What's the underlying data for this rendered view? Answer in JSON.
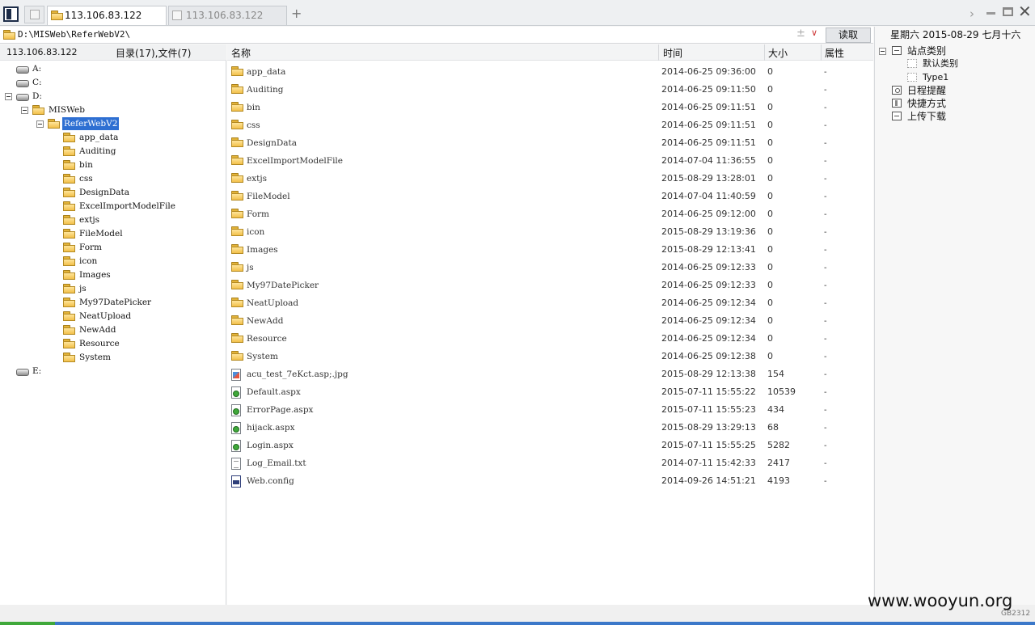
{
  "tabs": [
    {
      "label": "113.106.83.122",
      "active": true
    },
    {
      "label": "113.106.83.122",
      "active": false
    }
  ],
  "new_tab_label": "+",
  "address": {
    "path": "D:\\MISWeb\\ReferWebV2\\",
    "read_button": "读取"
  },
  "left": {
    "host": "113.106.83.122",
    "counts": "目录(17),文件(7)",
    "tree": [
      {
        "label": "A:",
        "type": "drive",
        "depth": 0
      },
      {
        "label": "C:",
        "type": "drive",
        "depth": 0
      },
      {
        "label": "D:",
        "type": "drive",
        "depth": 0,
        "expanded": true
      },
      {
        "label": "MISWeb",
        "type": "folder",
        "depth": 1,
        "expanded": true
      },
      {
        "label": "ReferWebV2",
        "type": "folder",
        "depth": 2,
        "expanded": true,
        "selected": true
      },
      {
        "label": "app_data",
        "type": "folder",
        "depth": 3
      },
      {
        "label": "Auditing",
        "type": "folder",
        "depth": 3
      },
      {
        "label": "bin",
        "type": "folder",
        "depth": 3
      },
      {
        "label": "css",
        "type": "folder",
        "depth": 3
      },
      {
        "label": "DesignData",
        "type": "folder",
        "depth": 3
      },
      {
        "label": "ExcelImportModelFile",
        "type": "folder",
        "depth": 3
      },
      {
        "label": "extjs",
        "type": "folder",
        "depth": 3
      },
      {
        "label": "FileModel",
        "type": "folder",
        "depth": 3
      },
      {
        "label": "Form",
        "type": "folder",
        "depth": 3
      },
      {
        "label": "icon",
        "type": "folder",
        "depth": 3
      },
      {
        "label": "Images",
        "type": "folder",
        "depth": 3
      },
      {
        "label": "js",
        "type": "folder",
        "depth": 3
      },
      {
        "label": "My97DatePicker",
        "type": "folder",
        "depth": 3
      },
      {
        "label": "NeatUpload",
        "type": "folder",
        "depth": 3
      },
      {
        "label": "NewAdd",
        "type": "folder",
        "depth": 3
      },
      {
        "label": "Resource",
        "type": "folder",
        "depth": 3
      },
      {
        "label": "System",
        "type": "folder",
        "depth": 3
      },
      {
        "label": "E:",
        "type": "drive",
        "depth": 0
      }
    ]
  },
  "columns": {
    "name": "名称",
    "time": "时间",
    "size": "大小",
    "attr": "属性"
  },
  "files": [
    {
      "name": "app_data",
      "time": "2014-06-25 09:36:00",
      "size": "0",
      "attr": "-",
      "icon": "folder"
    },
    {
      "name": "Auditing",
      "time": "2014-06-25 09:11:50",
      "size": "0",
      "attr": "-",
      "icon": "folder"
    },
    {
      "name": "bin",
      "time": "2014-06-25 09:11:51",
      "size": "0",
      "attr": "-",
      "icon": "folder"
    },
    {
      "name": "css",
      "time": "2014-06-25 09:11:51",
      "size": "0",
      "attr": "-",
      "icon": "folder"
    },
    {
      "name": "DesignData",
      "time": "2014-06-25 09:11:51",
      "size": "0",
      "attr": "-",
      "icon": "folder"
    },
    {
      "name": "ExcelImportModelFile",
      "time": "2014-07-04 11:36:55",
      "size": "0",
      "attr": "-",
      "icon": "folder"
    },
    {
      "name": "extjs",
      "time": "2015-08-29 13:28:01",
      "size": "0",
      "attr": "-",
      "icon": "folder"
    },
    {
      "name": "FileModel",
      "time": "2014-07-04 11:40:59",
      "size": "0",
      "attr": "-",
      "icon": "folder"
    },
    {
      "name": "Form",
      "time": "2014-06-25 09:12:00",
      "size": "0",
      "attr": "-",
      "icon": "folder"
    },
    {
      "name": "icon",
      "time": "2015-08-29 13:19:36",
      "size": "0",
      "attr": "-",
      "icon": "folder"
    },
    {
      "name": "Images",
      "time": "2015-08-29 12:13:41",
      "size": "0",
      "attr": "-",
      "icon": "folder"
    },
    {
      "name": "js",
      "time": "2014-06-25 09:12:33",
      "size": "0",
      "attr": "-",
      "icon": "folder"
    },
    {
      "name": "My97DatePicker",
      "time": "2014-06-25 09:12:33",
      "size": "0",
      "attr": "-",
      "icon": "folder"
    },
    {
      "name": "NeatUpload",
      "time": "2014-06-25 09:12:34",
      "size": "0",
      "attr": "-",
      "icon": "folder"
    },
    {
      "name": "NewAdd",
      "time": "2014-06-25 09:12:34",
      "size": "0",
      "attr": "-",
      "icon": "folder"
    },
    {
      "name": "Resource",
      "time": "2014-06-25 09:12:34",
      "size": "0",
      "attr": "-",
      "icon": "folder"
    },
    {
      "name": "System",
      "time": "2014-06-25 09:12:38",
      "size": "0",
      "attr": "-",
      "icon": "folder"
    },
    {
      "name": "acu_test_7eKct.asp;.jpg",
      "time": "2015-08-29 12:13:38",
      "size": "154",
      "attr": "-",
      "icon": "jpg"
    },
    {
      "name": "Default.aspx",
      "time": "2015-07-11 15:55:22",
      "size": "10539",
      "attr": "-",
      "icon": "aspx"
    },
    {
      "name": "ErrorPage.aspx",
      "time": "2015-07-11 15:55:23",
      "size": "434",
      "attr": "-",
      "icon": "aspx"
    },
    {
      "name": "hijack.aspx",
      "time": "2015-08-29 13:29:13",
      "size": "68",
      "attr": "-",
      "icon": "aspx"
    },
    {
      "name": "Login.aspx",
      "time": "2015-07-11 15:55:25",
      "size": "5282",
      "attr": "-",
      "icon": "aspx"
    },
    {
      "name": "Log_Email.txt",
      "time": "2014-07-11 15:42:33",
      "size": "2417",
      "attr": "-",
      "icon": "txt"
    },
    {
      "name": "Web.config",
      "time": "2014-09-26 14:51:21",
      "size": "4193",
      "attr": "-",
      "icon": "config"
    }
  ],
  "right": {
    "date": "星期六 2015-08-29 七月十六",
    "tree": [
      {
        "label": "站点类别",
        "icon": "minus-box",
        "depth": 0
      },
      {
        "label": "默认类别",
        "icon": "dotted-box",
        "depth": 1
      },
      {
        "label": "Type1",
        "icon": "dotted-box",
        "depth": 1
      },
      {
        "label": "日程提醒",
        "icon": "calendar",
        "depth": 0
      },
      {
        "label": "快捷方式",
        "icon": "hand",
        "depth": 0
      },
      {
        "label": "上传下载",
        "icon": "minus-box",
        "depth": 0
      }
    ]
  },
  "watermark": "www.wooyun.org",
  "encoding": "GB2312"
}
